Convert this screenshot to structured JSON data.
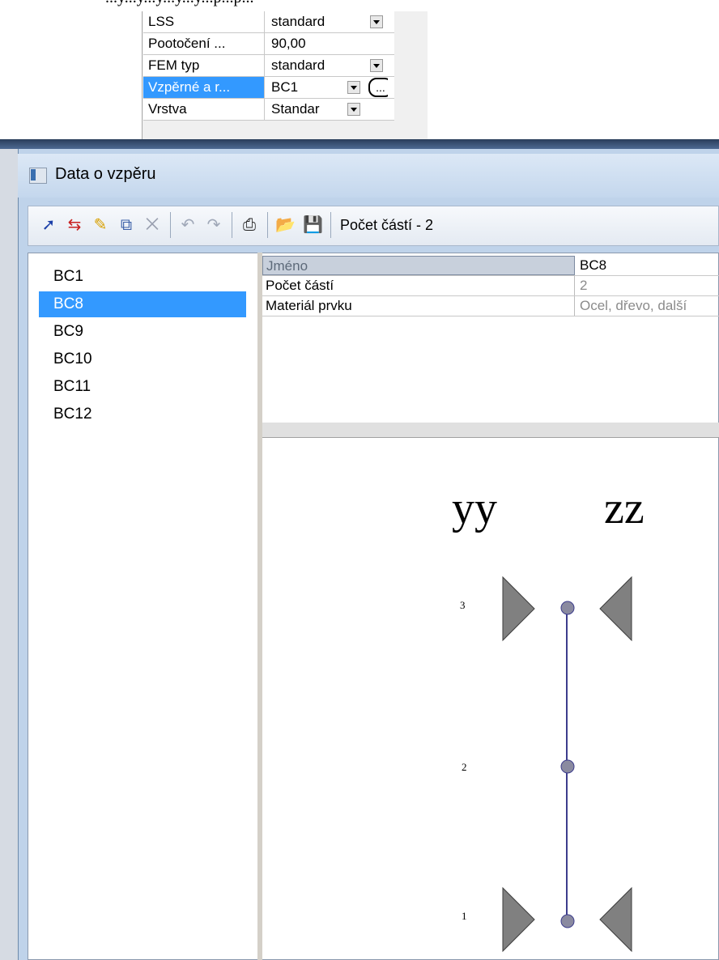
{
  "top_caption": "...y...y...y...y...y...p...p...",
  "properties": [
    {
      "name": "LSS",
      "value": "standard",
      "dropdown": true,
      "selected": false
    },
    {
      "name": "Pootočení ...",
      "value": "90,00",
      "dropdown": false,
      "selected": false
    },
    {
      "name": "FEM typ",
      "value": "standard",
      "dropdown": true,
      "selected": false
    },
    {
      "name": "Vzpěrné a r...",
      "value": "BC1",
      "dropdown": true,
      "selected": true,
      "ellipsis": "..."
    },
    {
      "name": "Vrstva",
      "value": "Standar",
      "dropdown": true,
      "selected": false
    }
  ],
  "dialog": {
    "title": "Data o vzpěru",
    "toolbar_status": "Počet částí - 2",
    "list": [
      "BC1",
      "BC8",
      "BC9",
      "BC10",
      "BC11",
      "BC12"
    ],
    "selected_index": 1,
    "grid": [
      {
        "name": "Jméno",
        "value": "BC8"
      },
      {
        "name": "Počet částí",
        "value": "2"
      },
      {
        "name": "Materiál prvku",
        "value": "Ocel, dřevo, další"
      }
    ],
    "diagram": {
      "axes": [
        "yy",
        "zz"
      ],
      "node_labels": [
        "3",
        "2",
        "1"
      ]
    }
  },
  "icons": [
    "new-icon",
    "insert-icon",
    "edit-icon",
    "copy-icon",
    "delete-icon",
    "undo-icon",
    "redo-icon",
    "print-icon",
    "open-icon",
    "save-icon"
  ],
  "colors": {
    "selection": "#3399ff",
    "diagram_line": "#3c3c8c",
    "support": "#808080"
  }
}
